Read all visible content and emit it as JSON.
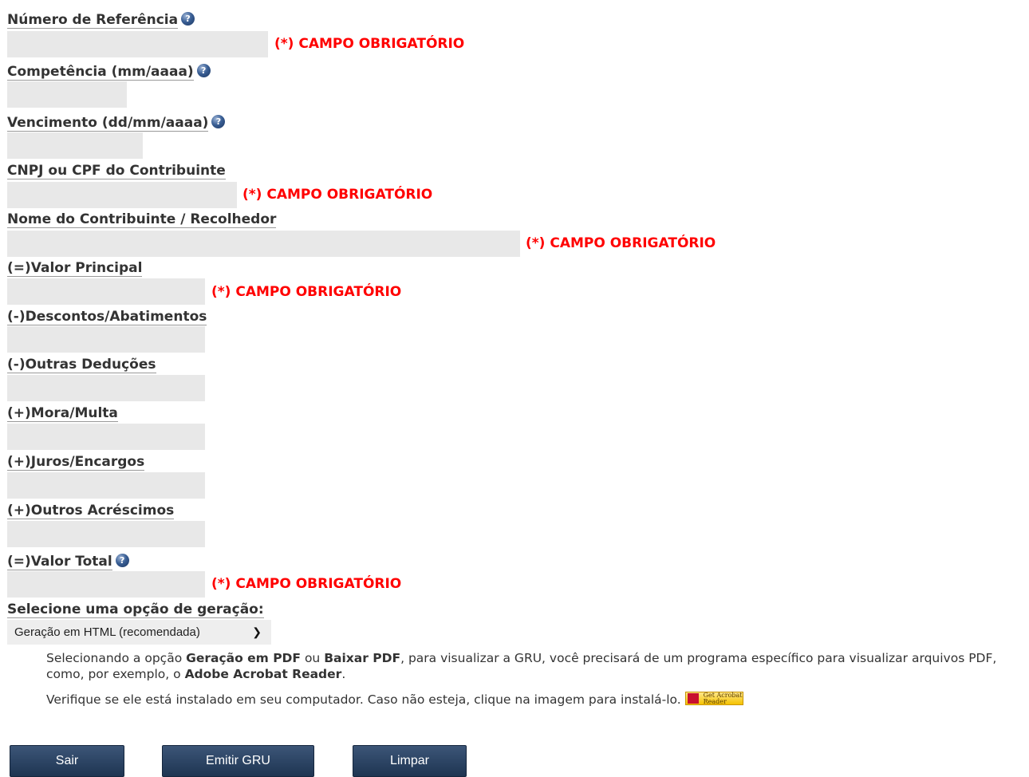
{
  "help_glyph": "?",
  "required_text": "(*) CAMPO OBRIGATÓRIO",
  "fields": {
    "referencia": {
      "label": "Número de Referência"
    },
    "competencia": {
      "label": "Competência (mm/aaaa)"
    },
    "vencimento": {
      "label": "Vencimento (dd/mm/aaaa)"
    },
    "cnpj": {
      "label": "CNPJ ou CPF do Contribuinte"
    },
    "nome": {
      "label": "Nome do Contribuinte / Recolhedor"
    },
    "valor_principal": {
      "label": "(=)Valor Principal"
    },
    "descontos": {
      "label": "(-)Descontos/Abatimentos"
    },
    "outras_deducoes": {
      "label": "(-)Outras Deduções"
    },
    "mora_multa": {
      "label": "(+)Mora/Multa"
    },
    "juros": {
      "label": "(+)Juros/Encargos"
    },
    "outros_acrescimos": {
      "label": "(+)Outros Acréscimos"
    },
    "valor_total": {
      "label": "(=)Valor Total"
    }
  },
  "geracao": {
    "label": "Selecione uma opção de geração:",
    "selected": "Geração em HTML (recomendada)"
  },
  "note": {
    "p1_a": "Selecionando a opção ",
    "p1_b": "Geração em PDF",
    "p1_c": " ou ",
    "p1_d": "Baixar PDF",
    "p1_e": ", para visualizar a GRU, você precisará de um programa específico para visualizar arquivos PDF, como, por exemplo, o ",
    "p1_f": "Adobe Acrobat Reader",
    "p1_g": ".",
    "p2": "Verifique se ele está instalado em seu computador. Caso não esteja, clique na imagem para instalá-lo.",
    "acrobat_text": "Get Acrobat Reader"
  },
  "buttons": {
    "sair": "Sair",
    "emitir": "Emitir GRU",
    "limpar": "Limpar"
  },
  "colors": {
    "required": "#ff0000",
    "field_bg": "#e8e8e8",
    "button_bg": "#2a4262"
  }
}
